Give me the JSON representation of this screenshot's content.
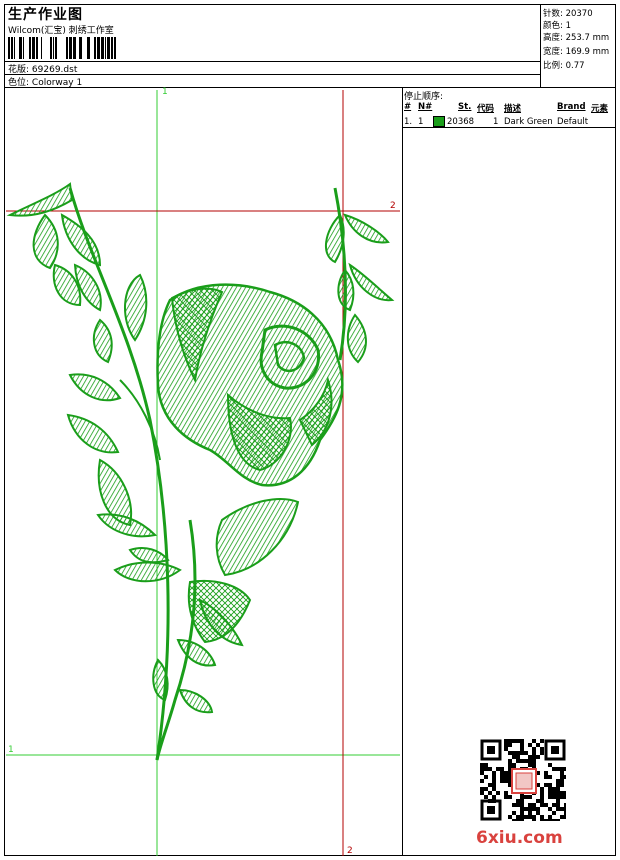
{
  "header": {
    "title": "生产作业图",
    "software": "Wilcom(汇宝) 刺绣工作室",
    "design_label": "花版:",
    "design_file": "69269.dst",
    "colorway_label": "色位:",
    "colorway_value": "Colorway 1"
  },
  "stats": [
    {
      "label": "针数:",
      "value": "20370"
    },
    {
      "label": "颜色:",
      "value": "1"
    },
    {
      "label": "高度:",
      "value": "253.7 mm"
    },
    {
      "label": "宽度:",
      "value": "169.9 mm"
    },
    {
      "label": "比例:",
      "value": "0.77"
    }
  ],
  "stop_sequence": {
    "title": "停止顺序:",
    "columns": [
      "#",
      "N#",
      "St.",
      "代码",
      "描述",
      "Brand",
      "元素"
    ],
    "rows": [
      {
        "index": "1.",
        "needle": "1",
        "stitches": "20368",
        "code": "1",
        "description": "Dark Green",
        "brand": "Default",
        "color": "#1a9e1a"
      }
    ]
  },
  "guides": {
    "green_label_top": "1",
    "green_label_left": "1",
    "red_label_right": "2",
    "red_label_bottom": "2"
  },
  "colors": {
    "stitch": "#1a9e1a",
    "guide_green": "#33cc33",
    "guide_red": "#b30000",
    "watermark": "#d9423e"
  },
  "watermark": "6xiu.com"
}
